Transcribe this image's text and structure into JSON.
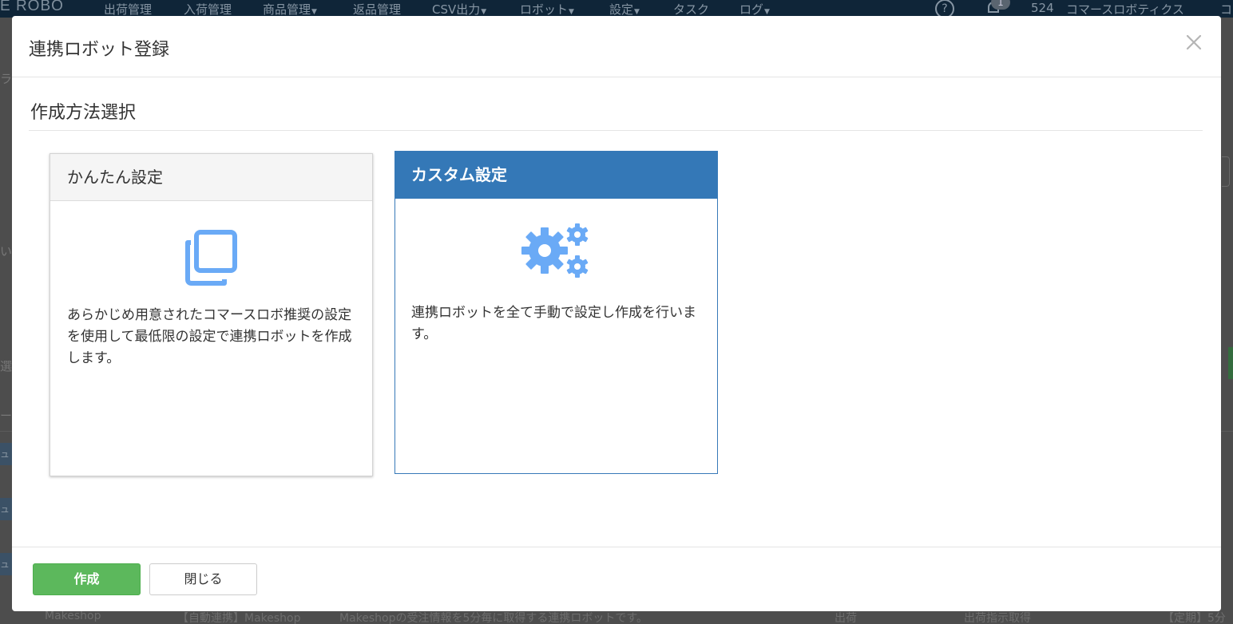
{
  "background": {
    "logo": "E ROBO",
    "nav": [
      {
        "label": "出荷管理",
        "has_caret": false
      },
      {
        "label": "入荷管理",
        "has_caret": false
      },
      {
        "label": "商品管理",
        "has_caret": true
      },
      {
        "label": "返品管理",
        "has_caret": false
      },
      {
        "label": "CSV出力",
        "has_caret": true
      },
      {
        "label": "ロボット",
        "has_caret": true
      },
      {
        "label": "設定",
        "has_caret": true
      },
      {
        "label": "タスク",
        "has_caret": false
      },
      {
        "label": "ログ",
        "has_caret": true
      }
    ],
    "help_glyph": "?",
    "notification_count": "1",
    "account_id": "524",
    "account_name": "コマースロボティクス",
    "edge_char": "コ",
    "left_fragments": [
      "ラ",
      "い",
      "選択",
      "ー"
    ],
    "left_labels": [
      "ュ",
      "ュ",
      "ュ"
    ],
    "bottom_row": [
      "Makeshop",
      "【自動連携】Makeshop",
      "Makeshopの受注情報を5分毎に取得する連携ロボットです。",
      "出荷",
      "出荷指示取得",
      "【定期】5分"
    ]
  },
  "modal": {
    "title": "連携ロボット登録",
    "section_title": "作成方法選択",
    "cards": {
      "simple": {
        "title": "かんたん設定",
        "icon": "copy-icon",
        "description": "あらかじめ用意されたコマースロボ推奨の設定を使用して最低限の設定で連携ロボットを作成します。",
        "selected": false
      },
      "custom": {
        "title": "カスタム設定",
        "icon": "gears-icon",
        "description": "連携ロボットを全て手動で設定し作成を行います。",
        "selected": true
      }
    },
    "buttons": {
      "create": "作成",
      "close": "閉じる"
    }
  },
  "colors": {
    "primary": "#3478b7",
    "success": "#5cb85c",
    "icon": "#6aaaf6",
    "navbar": "#0f2538"
  }
}
